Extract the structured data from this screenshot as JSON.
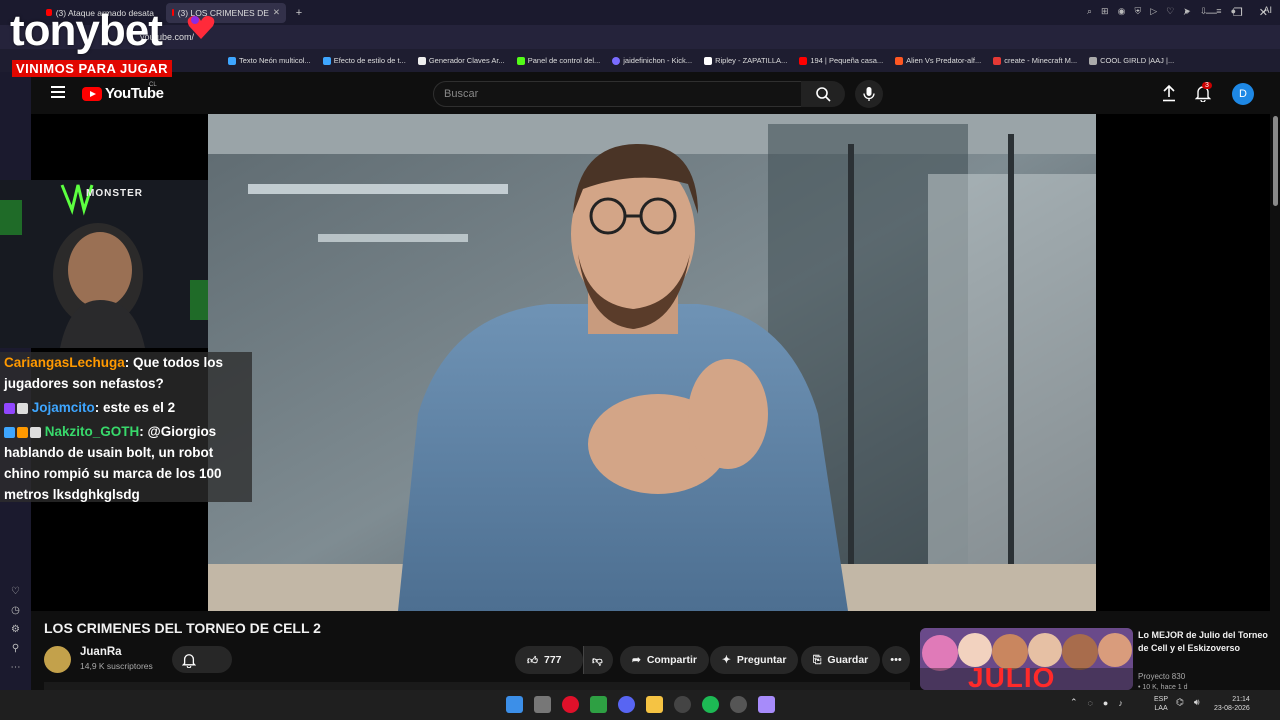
{
  "browser": {
    "tabs": [
      {
        "label": "(3) Ataque armado desata",
        "active": false
      },
      {
        "label": "(3) LOS CRIMENES DE",
        "active": true
      }
    ],
    "url": "youtube.com/",
    "ai_label": "AI",
    "bookmarks": [
      "Texto Neón multicol...",
      "Efecto de estilo de t...",
      "Generador Claves Ar...",
      "Panel de control del...",
      "jaidefinichon - Kick...",
      "Ripley - ZAPATILLA...",
      "194 | Pequeña casa...",
      "Alien Vs Predator-alf...",
      "create - Minecraft M...",
      "COOL GIRLD |AAJ |..."
    ]
  },
  "overlay": {
    "brand": "tonybet",
    "slogan": "VINIMOS PARA JUGAR",
    "sponsor": "MONSTER",
    "chat": [
      {
        "user": "CariangasLechuga",
        "text": ": Que todos los jugadores son nefastos?"
      },
      {
        "user": "Jojamcito",
        "text": ": este es el 2"
      },
      {
        "user": "Nakzito_GOTH",
        "text": ": @Giorgios hablando de usain bolt, un robot chino rompió su marca de los 100 metros lksdghkglsdg"
      }
    ]
  },
  "youtube": {
    "logo": "YouTube",
    "country": "CL",
    "search_placeholder": "Buscar",
    "notifications": "3",
    "account_initial": "D"
  },
  "video": {
    "title": "LOS CRIMENES DEL TORNEO DE CELL 2",
    "channel": "JuanRa",
    "subscribers": "14,9 K suscriptores",
    "likes": "777",
    "share": "Compartir",
    "ask": "Preguntar",
    "save": "Guardar"
  },
  "recommended": {
    "title": "Lo MEJOR de Julio del Torneo de Cell y el Eskizoverso",
    "channel": "Proyecto 830",
    "meta": "• 10 K, hace 1 d",
    "thumb_text": "JULIO"
  },
  "taskbar": {
    "lang_top": "ESP",
    "lang_bottom": "LAA",
    "time": "21:14",
    "date": "23-08-2026"
  },
  "colors": {
    "youtube_red": "#ff0000",
    "brand_red": "#e10600",
    "account_blue": "#1e88e5"
  }
}
